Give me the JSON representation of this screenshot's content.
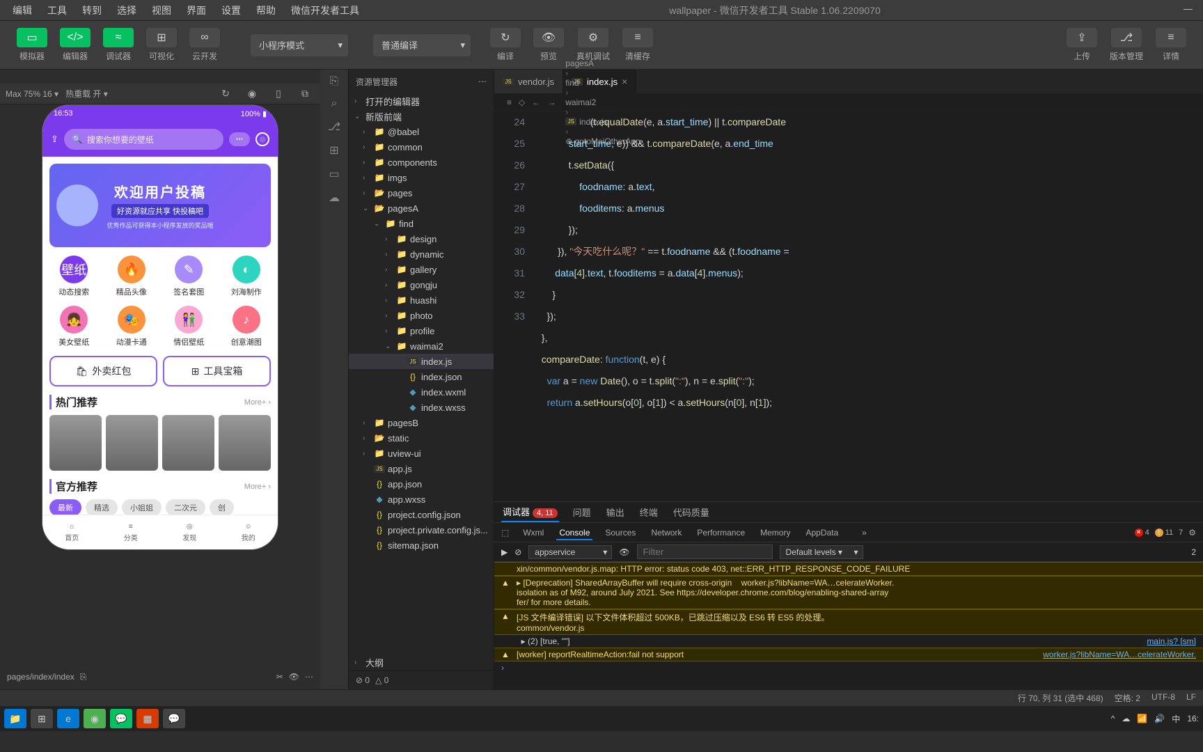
{
  "title": {
    "project": "wallpaper",
    "app": "微信开发者工具 Stable 1.06.2209070"
  },
  "menu": [
    "编辑",
    "工具",
    "转到",
    "选择",
    "视图",
    "界面",
    "设置",
    "帮助",
    "微信开发者工具"
  ],
  "toolbar": {
    "groups": {
      "left": [
        {
          "label": "模拟器",
          "green": true,
          "icon": "▭"
        },
        {
          "label": "编辑器",
          "green": true,
          "icon": "</>"
        },
        {
          "label": "调试器",
          "green": true,
          "icon": "≈"
        },
        {
          "label": "可视化",
          "green": false,
          "icon": "⊞"
        },
        {
          "label": "云开发",
          "green": false,
          "icon": "∞"
        }
      ],
      "center": [
        {
          "label": "编译",
          "icon": "↻"
        },
        {
          "label": "预览",
          "icon": "👁"
        },
        {
          "label": "真机调试",
          "icon": "⚙"
        },
        {
          "label": "清缓存",
          "icon": "≡"
        }
      ],
      "right": [
        {
          "label": "上传",
          "icon": "⇪"
        },
        {
          "label": "版本管理",
          "icon": "⎇"
        },
        {
          "label": "详情",
          "icon": "≡"
        }
      ]
    },
    "mode": "小程序模式",
    "compile_mode": "普通编译"
  },
  "subtoolbar": {
    "device": "Max 75% 16 ▾",
    "hotreload": "热重载 开 ▾"
  },
  "simulator": {
    "time": "16:53",
    "battery": "100% ▮",
    "search_placeholder": "搜索你想要的壁纸",
    "banner": {
      "title": "欢迎用户投稿",
      "sub": "好资源就应共享  快投稿吧",
      "small": "优秀作品可获得本小程序发放的奖品哦"
    },
    "icons": [
      {
        "label": "动态搜索",
        "color": "#7c3aed",
        "emoji": "壁纸"
      },
      {
        "label": "精品头像",
        "color": "#fb923c",
        "emoji": "🔥"
      },
      {
        "label": "签名套图",
        "color": "#a78bfa",
        "emoji": "✎"
      },
      {
        "label": "刘海制作",
        "color": "#2dd4bf",
        "emoji": "◐"
      },
      {
        "label": "美女壁纸",
        "color": "#f472b6",
        "emoji": "👧"
      },
      {
        "label": "动漫卡通",
        "color": "#fb923c",
        "emoji": "🎭"
      },
      {
        "label": "情侣壁纸",
        "color": "#f9a8d4",
        "emoji": "👫"
      },
      {
        "label": "创意潮图",
        "color": "#fb7185",
        "emoji": "♪"
      }
    ],
    "bigbtns": [
      {
        "label": "外卖红包",
        "icon": "🛍"
      },
      {
        "label": "工具宝箱",
        "icon": "⊞"
      }
    ],
    "section1": "热门推荐",
    "section2": "官方推荐",
    "more": "More+ ›",
    "chips": [
      "最新",
      "精选",
      "小姐姐",
      "二次元",
      "创"
    ],
    "tabbar": [
      {
        "label": "首页",
        "icon": "⌂"
      },
      {
        "label": "分类",
        "icon": "≡"
      },
      {
        "label": "发现",
        "icon": "◎"
      },
      {
        "label": "我的",
        "icon": "☺"
      }
    ],
    "footer_path": "pages/index/index"
  },
  "explorer": {
    "title": "资源管理器",
    "sections": {
      "open_editors": "打开的编辑器",
      "project": "新版前端",
      "outline": "大纲"
    },
    "tree": [
      {
        "d": 0,
        "t": "folder",
        "n": "@babel",
        "a": "›"
      },
      {
        "d": 0,
        "t": "folder",
        "n": "common",
        "a": "›"
      },
      {
        "d": 0,
        "t": "folder",
        "n": "components",
        "a": "›"
      },
      {
        "d": 0,
        "t": "folder",
        "n": "imgs",
        "a": "›"
      },
      {
        "d": 0,
        "t": "folder-o",
        "n": "pages",
        "a": "›"
      },
      {
        "d": 0,
        "t": "folder-o",
        "n": "pagesA",
        "a": "⌄"
      },
      {
        "d": 1,
        "t": "folder",
        "n": "find",
        "a": "⌄"
      },
      {
        "d": 2,
        "t": "folder",
        "n": "design",
        "a": "›"
      },
      {
        "d": 2,
        "t": "folder",
        "n": "dynamic",
        "a": "›"
      },
      {
        "d": 2,
        "t": "folder",
        "n": "gallery",
        "a": "›"
      },
      {
        "d": 2,
        "t": "folder",
        "n": "gongju",
        "a": "›"
      },
      {
        "d": 2,
        "t": "folder",
        "n": "huashi",
        "a": "›"
      },
      {
        "d": 2,
        "t": "folder",
        "n": "photo",
        "a": "›"
      },
      {
        "d": 2,
        "t": "folder",
        "n": "profile",
        "a": "›"
      },
      {
        "d": 2,
        "t": "folder",
        "n": "waimai2",
        "a": "⌄"
      },
      {
        "d": 3,
        "t": "js",
        "n": "index.js",
        "sel": true
      },
      {
        "d": 3,
        "t": "json",
        "n": "index.json"
      },
      {
        "d": 3,
        "t": "wxml",
        "n": "index.wxml"
      },
      {
        "d": 3,
        "t": "wxss",
        "n": "index.wxss"
      },
      {
        "d": 0,
        "t": "folder",
        "n": "pagesB",
        "a": "›"
      },
      {
        "d": 0,
        "t": "folder-o",
        "n": "static",
        "a": "›"
      },
      {
        "d": 0,
        "t": "folder",
        "n": "uview-ui",
        "a": "›"
      },
      {
        "d": 0,
        "t": "js",
        "n": "app.js"
      },
      {
        "d": 0,
        "t": "json",
        "n": "app.json"
      },
      {
        "d": 0,
        "t": "wxss",
        "n": "app.wxss"
      },
      {
        "d": 0,
        "t": "json",
        "n": "project.config.json"
      },
      {
        "d": 0,
        "t": "json",
        "n": "project.private.config.js..."
      },
      {
        "d": 0,
        "t": "json",
        "n": "sitemap.json"
      }
    ],
    "footer": {
      "err": "0",
      "warn": "0"
    }
  },
  "editor": {
    "tabs": [
      {
        "name": "vendor.js",
        "active": false
      },
      {
        "name": "index.js",
        "active": true
      }
    ],
    "breadcrumb": [
      "pagesA",
      "find",
      "waimai2",
      "index.js",
      "gotoMeiOtherApp"
    ],
    "gutter": [
      "",
      "24",
      "25",
      "26",
      "27",
      "",
      "28",
      "29",
      "30",
      "31",
      "32",
      "33"
    ],
    "lines": [
      "                    (t.equalDate(e, a.start_time) || t.compareDate",
      "            start_time, e)) && t.compareDate(e, a.end_time",
      "            t.setData({",
      "                foodname: a.text,",
      "                fooditems: a.menus",
      "            });",
      "        }), \"今天吃什么呢？\" == t.foodname && (t.foodname =",
      "       data[4].text, t.fooditems = a.data[4].menus);",
      "      }",
      "    });",
      "  },",
      "  compareDate: function(t, e) {",
      "    var a = new Date(), o = t.split(\":\"), n = e.split(\":\");",
      "    return a.setHours(o[0], o[1]) < a.setHours(n[0], n[1]);"
    ]
  },
  "panel": {
    "tabs": [
      "调试器",
      "问题",
      "输出",
      "终端",
      "代码质量"
    ],
    "badge": "4, 11",
    "devtabs": [
      "Wxml",
      "Console",
      "Sources",
      "Network",
      "Performance",
      "Memory",
      "AppData"
    ],
    "devtabs_more": "»",
    "errors": "4",
    "warnings": "11",
    "infos": "7",
    "context": "appservice",
    "filter_placeholder": "Filter",
    "levels": "Default levels ▾",
    "hidden": "2",
    "logs": [
      {
        "type": "warn",
        "icon": "",
        "text": "xin/common/vendor.js.map: HTTP error: status code 403, net::ERR_HTTP_RESPONSE_CODE_FAILURE",
        "link": ""
      },
      {
        "type": "warn",
        "icon": "▲",
        "text": "▸ [Deprecation] SharedArrayBuffer will require cross-origin    worker.js?libName=WA…celerateWorker.\nisolation as of M92, around July 2021. See https://developer.chrome.com/blog/enabling-shared-array\nfer/ for more details.",
        "link": ""
      },
      {
        "type": "warn",
        "icon": "▲",
        "text": "[JS 文件编译错误] 以下文件体积超过 500KB，已跳过压缩以及 ES6 转 ES5 的处理。\ncommon/vendor.js",
        "link": ""
      },
      {
        "type": "plain",
        "icon": "",
        "text": "  ▸ (2) [true, \"\"]",
        "link": "main.js? [sm]"
      },
      {
        "type": "warn",
        "icon": "▲",
        "text": "[worker] reportRealtimeAction:fail not support",
        "link": "worker.js?libName=WA…celerateWorker."
      }
    ]
  },
  "statusbar": {
    "pos": "行 70, 列 31 (选中 468)",
    "spaces": "空格: 2",
    "encoding": "UTF-8",
    "eol": "LF"
  },
  "taskbar": {
    "ime": "中",
    "time": "16:"
  }
}
